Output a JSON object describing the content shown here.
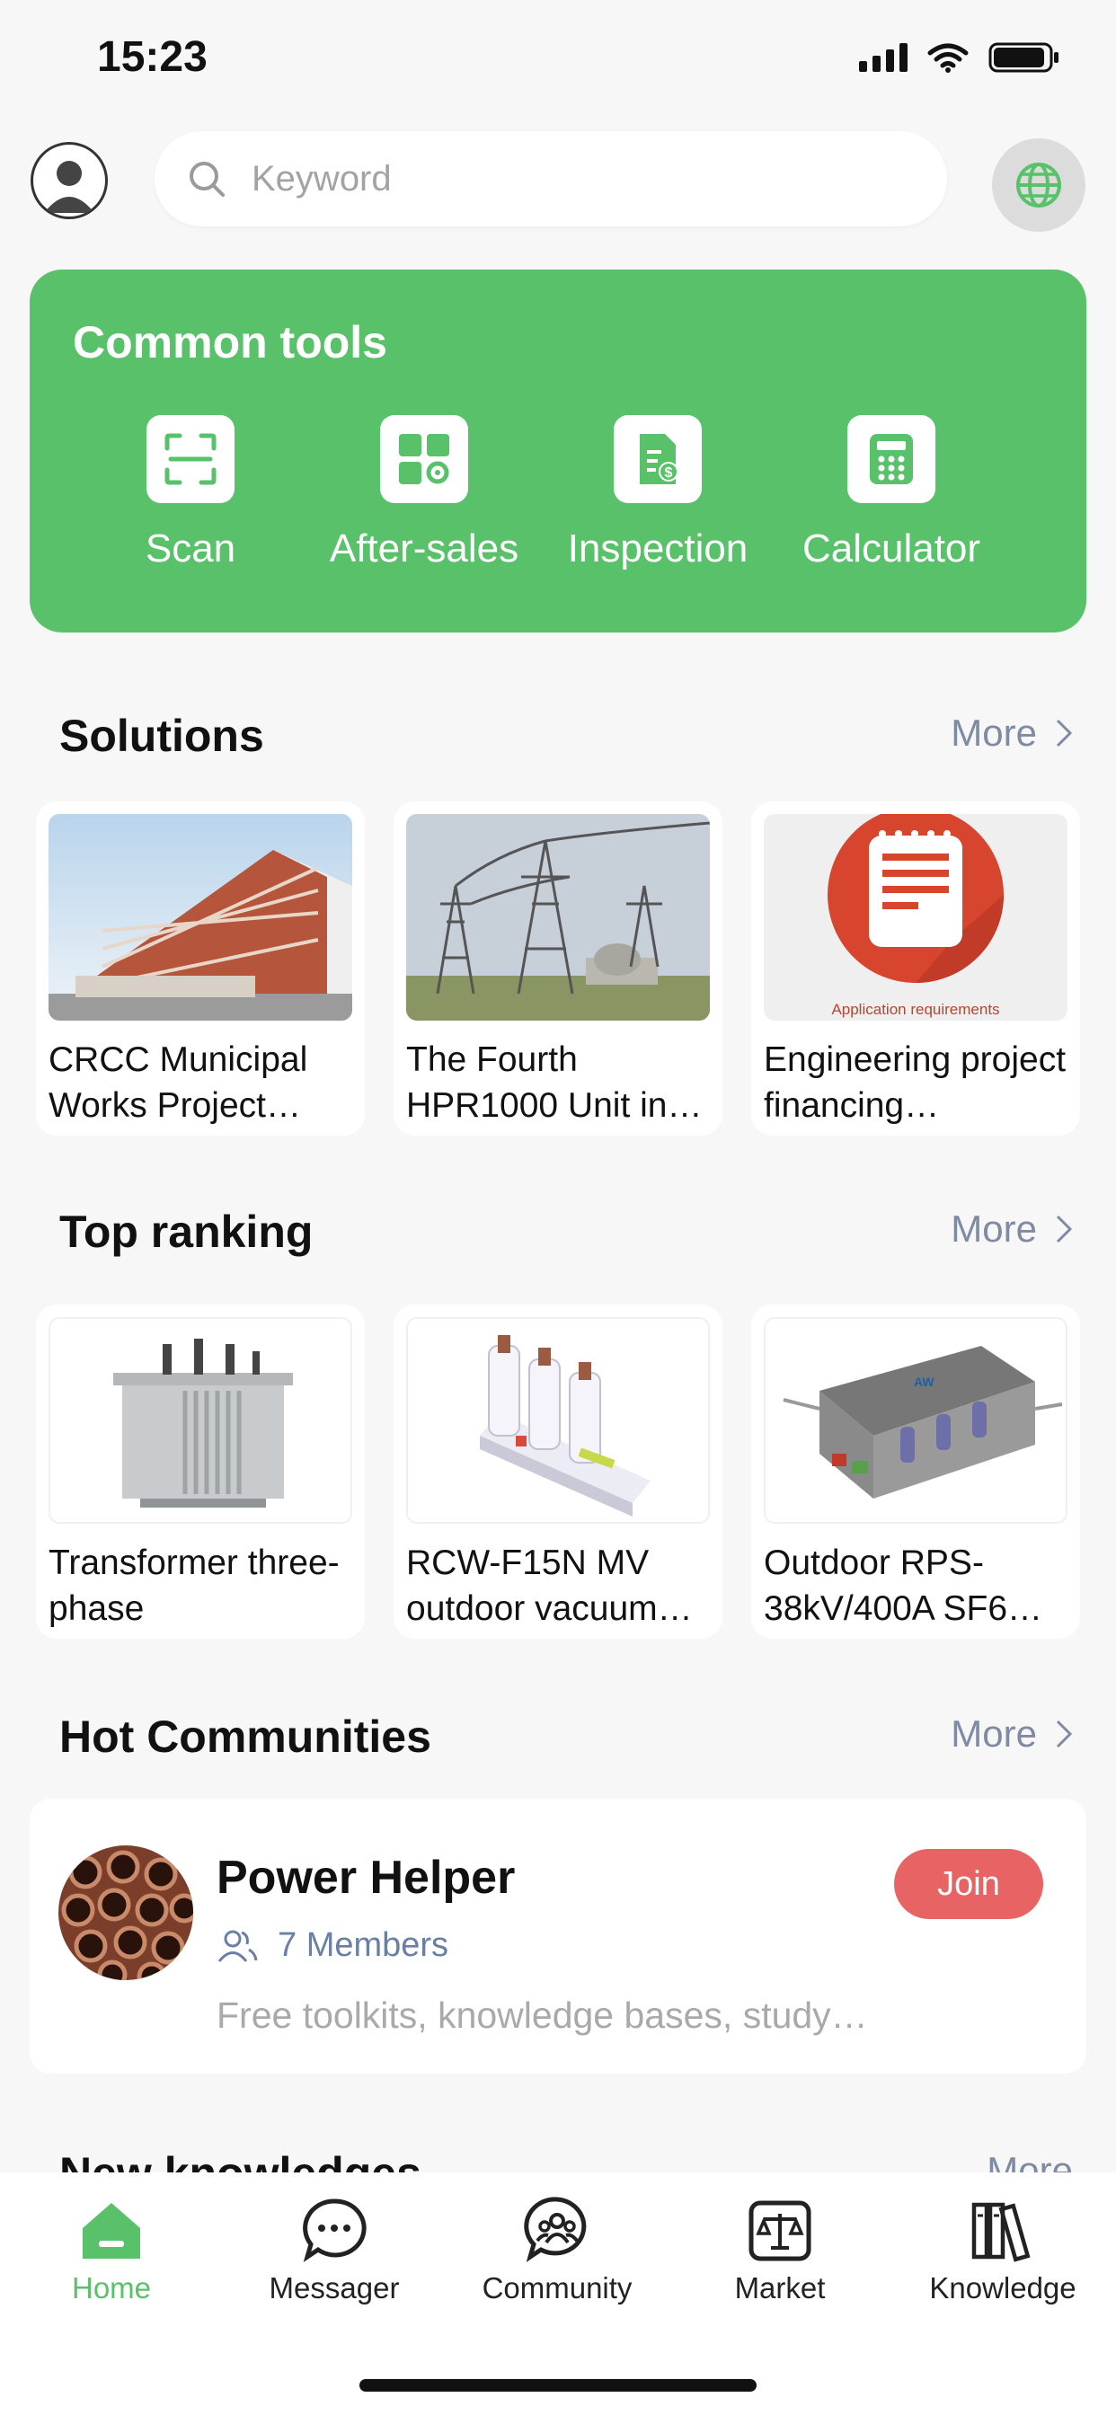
{
  "status_bar": {
    "time": "15:23"
  },
  "header": {
    "search_placeholder": "Keyword",
    "avatar_icon": "user-avatar-icon",
    "language_icon": "globe-icon"
  },
  "common_tools": {
    "title": "Common tools",
    "items": [
      {
        "label": "Scan",
        "icon": "scan-icon"
      },
      {
        "label": "After-sales",
        "icon": "after-sales-icon"
      },
      {
        "label": "Inspection",
        "icon": "inspection-icon"
      },
      {
        "label": "Calculator",
        "icon": "calculator-icon"
      }
    ]
  },
  "solutions": {
    "title": "Solutions",
    "more_label": "More",
    "items": [
      {
        "title": "CRCC Municipal Works Project…"
      },
      {
        "title": "The Fourth HPR1000 Unit in…"
      },
      {
        "title": "Engineering project financing…",
        "image_caption": "Application requirements"
      }
    ]
  },
  "top_ranking": {
    "title": "Top ranking",
    "more_label": "More",
    "items": [
      {
        "title": "Transformer three-phase"
      },
      {
        "title": "RCW-F15N MV outdoor vacuum…"
      },
      {
        "title": "Outdoor RPS-38kV/400A SF6…"
      }
    ]
  },
  "hot_communities": {
    "title": "Hot Communities",
    "more_label": "More",
    "community": {
      "name": "Power Helper",
      "members": "7 Members",
      "description": "Free toolkits, knowledge bases, study…",
      "join_label": "Join"
    }
  },
  "new_knowledges": {
    "title": "New knowledges",
    "more_label": "More"
  },
  "bottom_nav": {
    "items": [
      {
        "label": "Home",
        "icon": "home-icon",
        "active": true
      },
      {
        "label": "Messager",
        "icon": "message-icon"
      },
      {
        "label": "Community",
        "icon": "community-icon"
      },
      {
        "label": "Market",
        "icon": "market-icon"
      },
      {
        "label": "Knowledge",
        "icon": "knowledge-icon"
      }
    ]
  },
  "colors": {
    "accent": "#58c16a",
    "join": "#e86464",
    "more": "#7f8aa3"
  }
}
